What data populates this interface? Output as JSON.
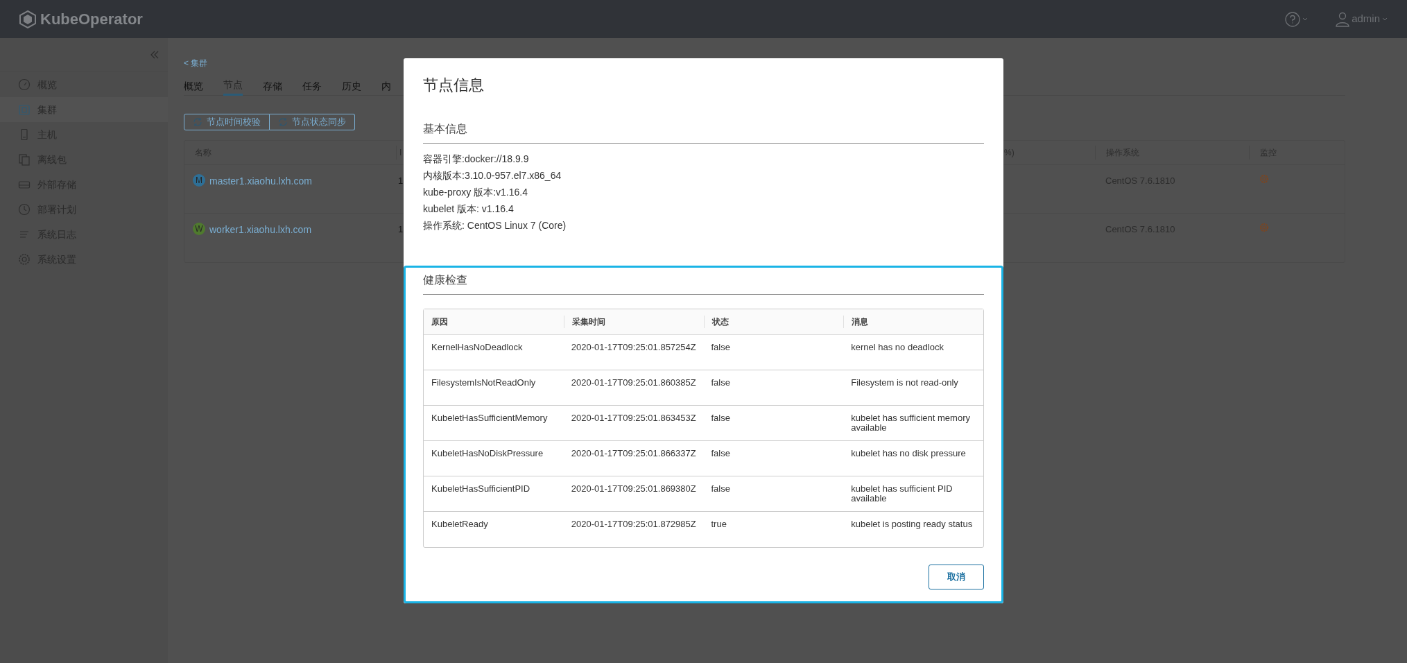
{
  "header": {
    "logo_text": "KubeOperator",
    "user": "admin"
  },
  "sidebar": {
    "items": [
      {
        "kind": "gauge",
        "label": "概览",
        "selected": false
      },
      {
        "kind": "cluster",
        "label": "集群",
        "selected": true
      },
      {
        "kind": "host",
        "label": "主机",
        "selected": false
      },
      {
        "kind": "package",
        "label": "离线包",
        "selected": false
      },
      {
        "kind": "storage",
        "label": "外部存储",
        "selected": false
      },
      {
        "kind": "clock",
        "label": "部署计划",
        "selected": false
      },
      {
        "kind": "log",
        "label": "系统日志",
        "selected": false
      },
      {
        "kind": "gear",
        "label": "系统设置",
        "selected": false
      }
    ]
  },
  "page": {
    "breadcrumb": "< 集群",
    "tabs": [
      {
        "label": "概览",
        "selected": false
      },
      {
        "label": "节点",
        "selected": true
      },
      {
        "label": "存储",
        "selected": false
      },
      {
        "label": "任务",
        "selected": false
      },
      {
        "label": "历史",
        "selected": false
      },
      {
        "label": "内",
        "selected": false
      }
    ],
    "actions": [
      "节点时间校验",
      "节点状态同步"
    ],
    "table": {
      "columns": [
        "名称",
        "I",
        "%)",
        "操作系统",
        "监控"
      ],
      "rows": [
        {
          "badge": "M",
          "color": "#2e6f96",
          "name": "master1.xiaohu.lxh.com",
          "column_2": "1",
          "os": "CentOS 7.6.1810"
        },
        {
          "badge": "W",
          "color": "#4f7a2e",
          "name": "worker1.xiaohu.lxh.com",
          "column_2": "1",
          "os": "CentOS 7.6.1810"
        }
      ]
    }
  },
  "modal": {
    "title": "节点信息",
    "basic_info": {
      "heading": "基本信息",
      "lines": [
        "容器引擎:docker://18.9.9",
        "内核版本:3.10.0-957.el7.x86_64",
        "kube-proxy 版本:v1.16.4",
        "kubelet 版本: v1.16.4",
        "操作系统: CentOS Linux 7 (Core)"
      ]
    },
    "health_check": {
      "heading": "健康检查",
      "columns": [
        "原因",
        "采集时间",
        "状态",
        "消息"
      ],
      "rows": [
        {
          "reason": "KernelHasNoDeadlock",
          "time": "2020-01-17T09:25:01.857254Z",
          "status": "false",
          "message": "kernel has no deadlock"
        },
        {
          "reason": "FilesystemIsNotReadOnly",
          "time": "2020-01-17T09:25:01.860385Z",
          "status": "false",
          "message": "Filesystem is not read-only"
        },
        {
          "reason": "KubeletHasSufficientMemory",
          "time": "2020-01-17T09:25:01.863453Z",
          "status": "false",
          "message": "kubelet has sufficient memory available"
        },
        {
          "reason": "KubeletHasNoDiskPressure",
          "time": "2020-01-17T09:25:01.866337Z",
          "status": "false",
          "message": "kubelet has no disk pressure"
        },
        {
          "reason": "KubeletHasSufficientPID",
          "time": "2020-01-17T09:25:01.869380Z",
          "status": "false",
          "message": "kubelet has sufficient PID available"
        },
        {
          "reason": "KubeletReady",
          "time": "2020-01-17T09:25:01.872985Z",
          "status": "true",
          "message": "kubelet is posting ready status"
        }
      ]
    },
    "buttons": [
      "取消"
    ]
  }
}
